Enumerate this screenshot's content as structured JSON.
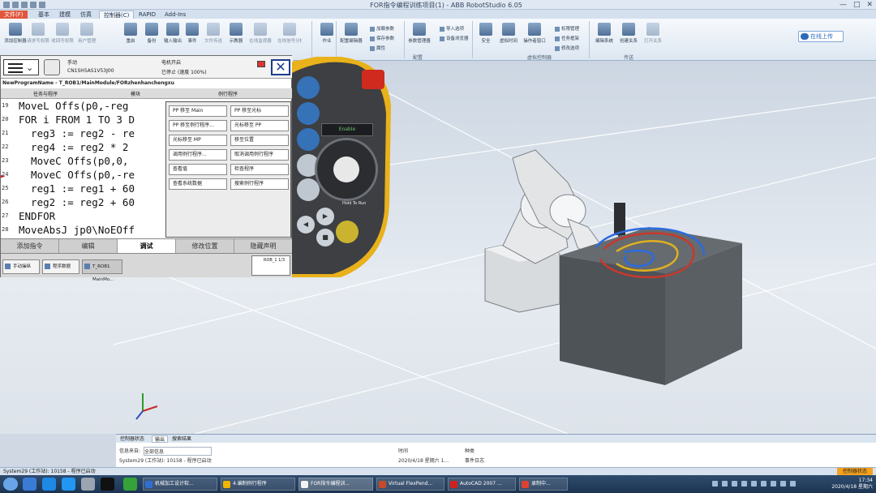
{
  "window": {
    "title": "FOR指令编程训练项目(1) - ABB RobotStudio 6.05",
    "controls": [
      "—",
      "□",
      "✕"
    ]
  },
  "ribbon": {
    "tabs": [
      "文件(F)",
      "基本",
      "建模",
      "仿真",
      "控制器(C)",
      "RAPID",
      "Add-Ins"
    ],
    "buttons": [
      {
        "label": "添加控制器",
        "dim": false
      },
      {
        "label": "请求写权限",
        "dim": true
      },
      {
        "label": "收回写权限",
        "dim": true
      },
      {
        "label": "用户管理",
        "dim": true
      },
      {
        "label": "重启",
        "dim": false
      },
      {
        "label": "备份",
        "dim": false
      },
      {
        "label": "输入输出",
        "dim": false
      },
      {
        "label": "事件",
        "dim": false
      },
      {
        "label": "文件传送",
        "dim": true
      },
      {
        "label": "示教器",
        "dim": false
      },
      {
        "label": "在线监视器",
        "dim": true
      },
      {
        "label": "在线信号分析器",
        "dim": true
      },
      {
        "label": "作业",
        "dim": false
      },
      {
        "label": "配置编辑器",
        "dim": false
      },
      {
        "label": "参数管理器",
        "dim": false
      },
      {
        "label": "安全",
        "dim": false
      },
      {
        "label": "虚拟时间",
        "dim": false
      },
      {
        "label": "操作者窗口",
        "dim": false
      },
      {
        "label": "编辑系统",
        "dim": false
      },
      {
        "label": "创建关系",
        "dim": false
      },
      {
        "label": "打开关系",
        "dim": true
      }
    ],
    "small_items": [
      "加载参数",
      "保存参数",
      "属性",
      "导入选项",
      "设备浏览器",
      "权限管理",
      "任务框架",
      "修改选项"
    ],
    "groups": [
      "配置",
      "虚拟控制器",
      "传送"
    ],
    "cloud_button": "在线上传"
  },
  "flexpendant": {
    "status_mode": "手动",
    "status_system": "CN1SH5AS1V53J00",
    "status_motor": "电机开启",
    "status_speed": "已停止 (速度 100%)",
    "path": "NewProgramName - T_ROB1/MainModule/FORzhenhanchengxu",
    "columns": [
      "任务与程序",
      "模块",
      "例行程序"
    ],
    "code_lines": [
      {
        "n": "19",
        "t": "MoveL Offs(p0,-reg"
      },
      {
        "n": "20",
        "t": "FOR i FROM 1 TO 3 D"
      },
      {
        "n": "21",
        "t": "  reg3 := reg2 - re"
      },
      {
        "n": "22",
        "t": "  reg4 := reg2 * 2"
      },
      {
        "n": "23",
        "t": "  MoveC Offs(p0,0,"
      },
      {
        "n": "24",
        "t": "  MoveC Offs(p0,-re"
      },
      {
        "n": "25",
        "t": "  reg1 := reg1 + 60"
      },
      {
        "n": "26",
        "t": "  reg2 := reg2 + 60"
      },
      {
        "n": "27",
        "t": "ENDFOR"
      },
      {
        "n": "28",
        "t": "MoveAbsJ jp0\\NoEOff"
      }
    ],
    "popup": [
      "PP 移至 Main",
      "PP 移至光标",
      "PP 移至例行程序...",
      "光标移至 PP",
      "光标移至 MP",
      "移至位置",
      "调用例行程序...",
      "取消调用例行程序",
      "查看值",
      "检查程序",
      "查看系统数据",
      "搜索例行程序"
    ],
    "tabs": [
      "添加指令",
      "编辑",
      "调试",
      "修改位置",
      "隐藏声明"
    ],
    "active_tab": "调试",
    "taskbar": [
      "手动操纵",
      "程序数据",
      "T_ROB1 MainMo..."
    ],
    "quickset": "ROB_1 1/3"
  },
  "controller": {
    "display": "Enable",
    "hold_label": "Hold To Run"
  },
  "output": {
    "tabs": [
      "控制器状态",
      "输出",
      "搜索结果"
    ],
    "filter_label": "信息来自:",
    "filter_value": "全部信息",
    "columns": [
      "时间",
      "种类"
    ],
    "row": {
      "source": "System29 (工作站): 10158 - 程序已启动",
      "time": "2020/4/18 星期六 1...",
      "category": "事件日志"
    }
  },
  "statusbar": {
    "left": "System29 (工作站): 10158 - 程序已启动",
    "right": "控制器状态"
  },
  "taskbar": {
    "apps": [
      {
        "label": "机械加工设计软...",
        "color": "#2f6fd1"
      },
      {
        "label": "4.编制例行程序",
        "color": "#f2b400"
      },
      {
        "label": "FOR指令编程训...",
        "color": "#f2f2f2"
      },
      {
        "label": "Virtual FlexPend...",
        "color": "#c84a2b"
      },
      {
        "label": "AutoCAD 2007 ...",
        "color": "#d02020"
      },
      {
        "label": "录制中...",
        "color": "#e04030"
      }
    ],
    "time": "17:34",
    "date": "2020/4/18 星期六"
  }
}
